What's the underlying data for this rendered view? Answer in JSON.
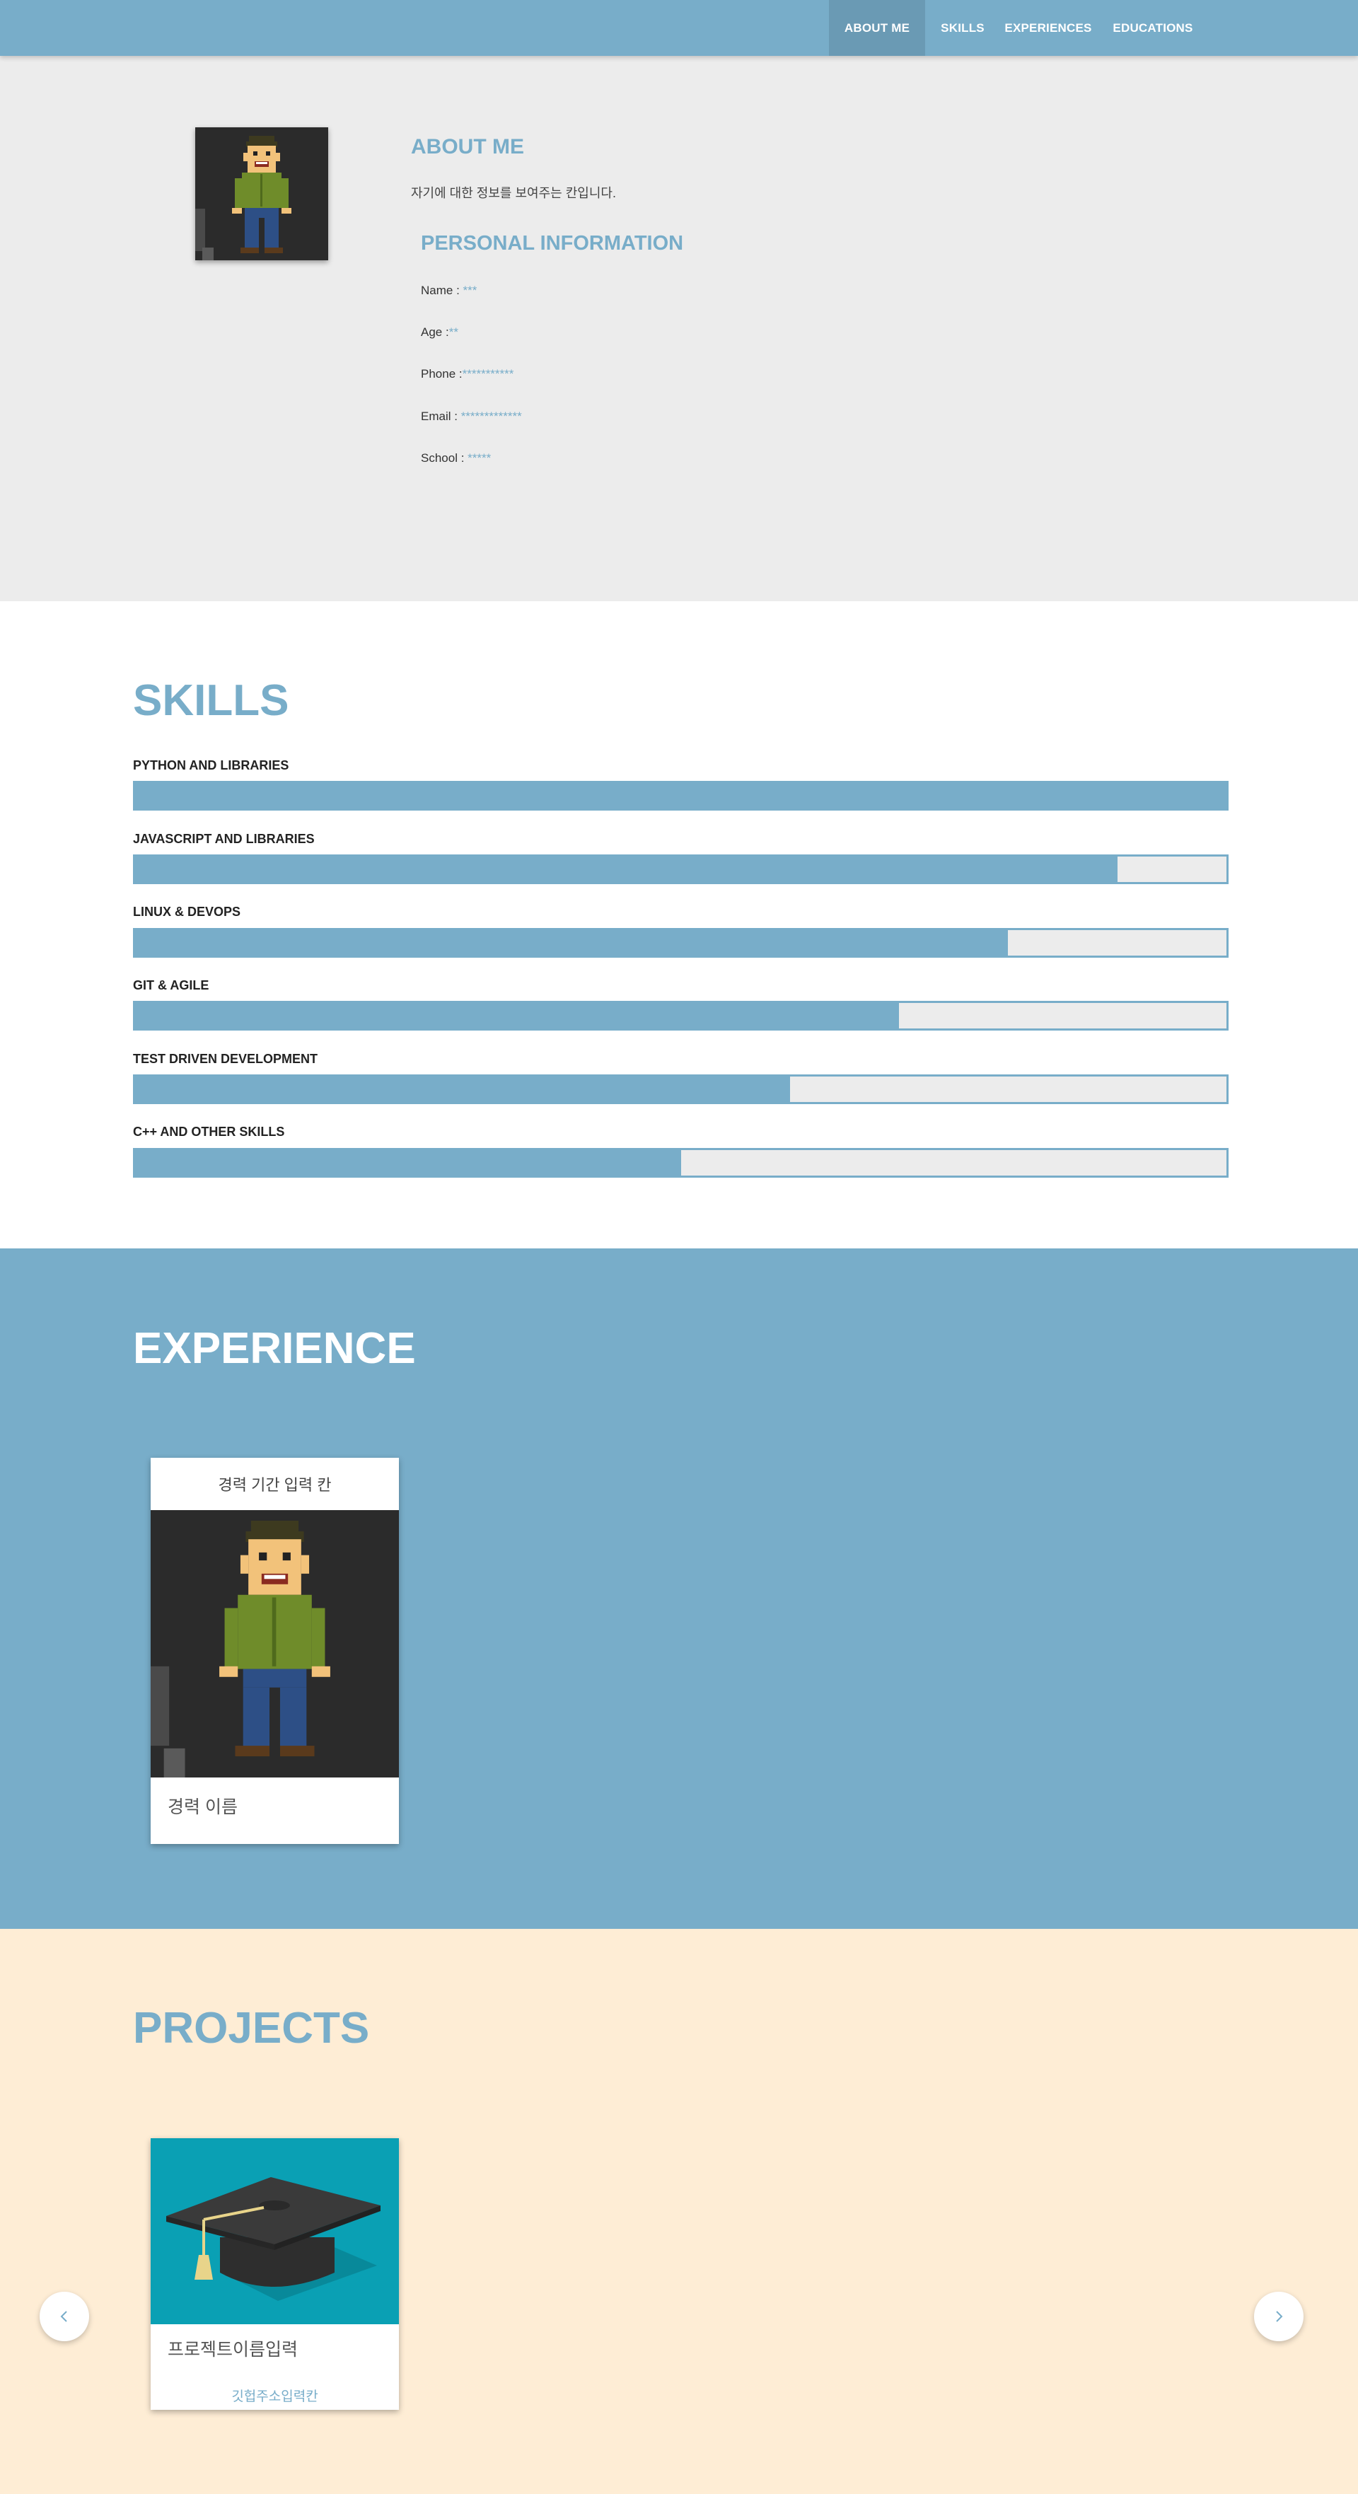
{
  "nav": {
    "items": [
      {
        "label": "ABOUT ME"
      },
      {
        "label": "SKILLS"
      },
      {
        "label": "EXPERIENCES"
      },
      {
        "label": "EDUCATIONS"
      }
    ],
    "active": "ABOUT ME"
  },
  "about": {
    "title": "ABOUT ME",
    "description": "자기에 대한 정보를 보여주는 칸입니다.",
    "personal_title": "PERSONAL INFORMATION",
    "info": [
      {
        "label": "Name : ",
        "value": "***"
      },
      {
        "label": "Age :",
        "value": "**"
      },
      {
        "label": "Phone :",
        "value": "***********"
      },
      {
        "label": "Email : ",
        "value": "*************"
      },
      {
        "label": "School : ",
        "value": "*****"
      }
    ]
  },
  "skills": {
    "title": "SKILLS",
    "items": [
      {
        "label": "PYTHON AND LIBRARIES",
        "level": 1.0
      },
      {
        "label": "JAVASCRIPT AND LIBRARIES",
        "level": 0.9
      },
      {
        "label": "LINUX & DEVOPS",
        "level": 0.8
      },
      {
        "label": "GIT & AGILE",
        "level": 0.7
      },
      {
        "label": "TEST DRIVEN DEVELOPMENT",
        "level": 0.6
      },
      {
        "label": "C++ AND OTHER SKILLS",
        "level": 0.5
      }
    ]
  },
  "experience": {
    "title": "EXPERIENCE",
    "card": {
      "period": "경력 기간 입력 칸",
      "name": "경력 이름"
    }
  },
  "projects": {
    "title": "PROJECTS",
    "card": {
      "name": "프로젝트이름입력",
      "link": "깃헙주소입력칸"
    },
    "prev_icon": "chevron-left-icon",
    "next_icon": "chevron-right-icon"
  },
  "colors": {
    "accent": "#78adc9",
    "about_bg": "#ececec",
    "projects_bg": "#feedd5",
    "project_image_bg": "#0aa0b4"
  }
}
